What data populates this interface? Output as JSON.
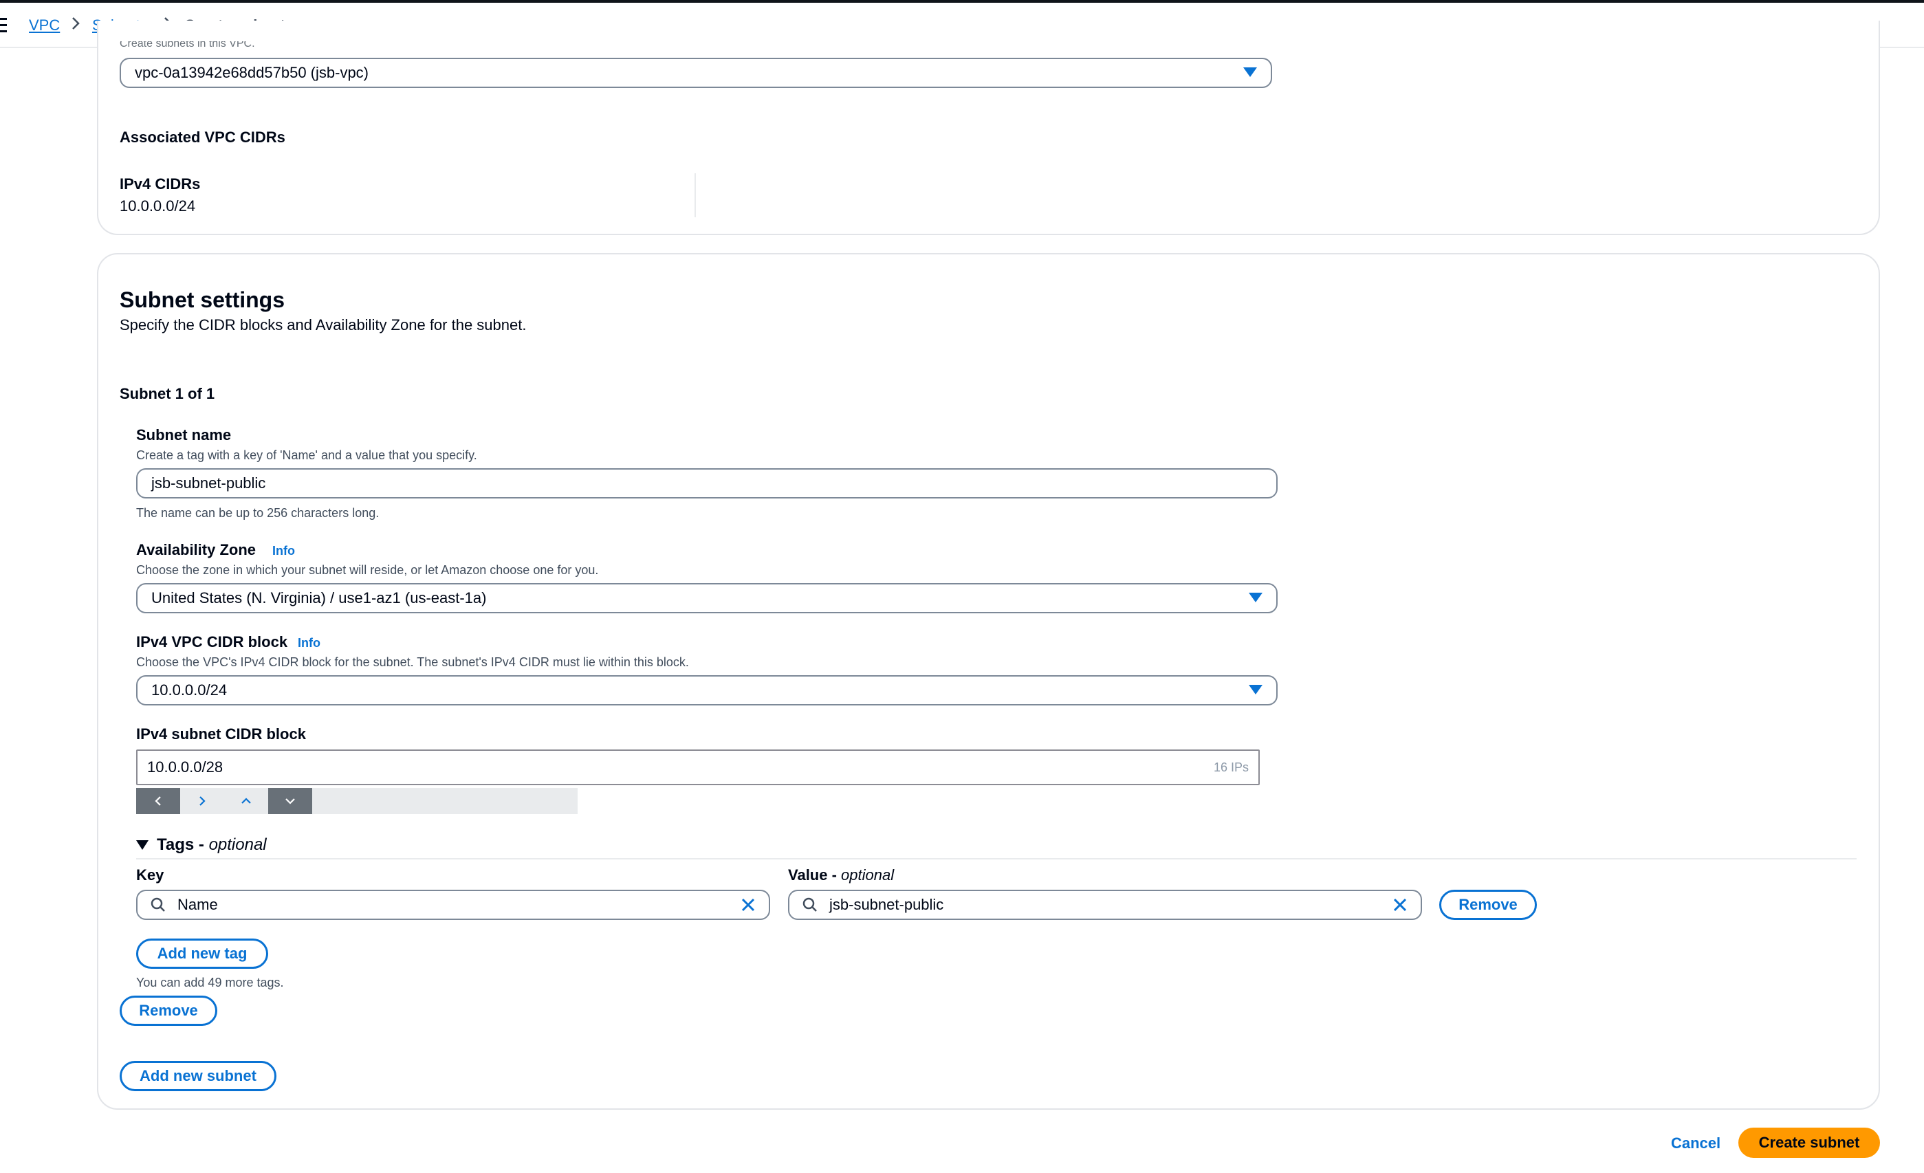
{
  "breadcrumb": {
    "items": [
      "VPC",
      "Subnets"
    ],
    "current": "Create subnet"
  },
  "vpc_section": {
    "cut_label": "Create subnets in this VPC.",
    "vpc_select_value": "vpc-0a13942e68dd57b50 (jsb-vpc)",
    "associated_title": "Associated VPC CIDRs",
    "ipv4_cidrs_label": "IPv4 CIDRs",
    "ipv4_cidrs_value": "10.0.0.0/24"
  },
  "subnet_settings": {
    "title": "Subnet settings",
    "description": "Specify the CIDR blocks and Availability Zone for the subnet.",
    "subnet_counter": "Subnet 1 of 1",
    "subnet_name": {
      "label": "Subnet name",
      "description": "Create a tag with a key of 'Name' and a value that you specify.",
      "value": "jsb-subnet-public",
      "hint": "The name can be up to 256 characters long."
    },
    "availability_zone": {
      "label": "Availability Zone",
      "info": "Info",
      "description": "Choose the zone in which your subnet will reside, or let Amazon choose one for you.",
      "value": "United States (N. Virginia) / use1-az1 (us-east-1a)"
    },
    "ipv4_vpc_cidr": {
      "label": "IPv4 VPC CIDR block",
      "info": "Info",
      "description": "Choose the VPC's IPv4 CIDR block for the subnet. The subnet's IPv4 CIDR must lie within this block.",
      "value": "10.0.0.0/24"
    },
    "ipv4_subnet_cidr": {
      "label": "IPv4 subnet CIDR block",
      "value": "10.0.0.0/28",
      "suffix": "16 IPs"
    },
    "tags": {
      "title": "Tags",
      "title_optional": "optional",
      "title_sep": " - ",
      "key_label": "Key",
      "value_label": "Value",
      "value_optional": "optional",
      "key_value": "Name",
      "value_value": "jsb-subnet-public",
      "remove_tag_label": "Remove",
      "add_tag_label": "Add new tag",
      "limit_hint": "You can add 49 more tags."
    },
    "remove_subnet_label": "Remove",
    "add_subnet_label": "Add new subnet"
  },
  "footer": {
    "cancel_label": "Cancel",
    "create_label": "Create subnet"
  },
  "colors": {
    "link": "#0972d3",
    "primary_button": "#ff9900",
    "text": "#000716"
  }
}
